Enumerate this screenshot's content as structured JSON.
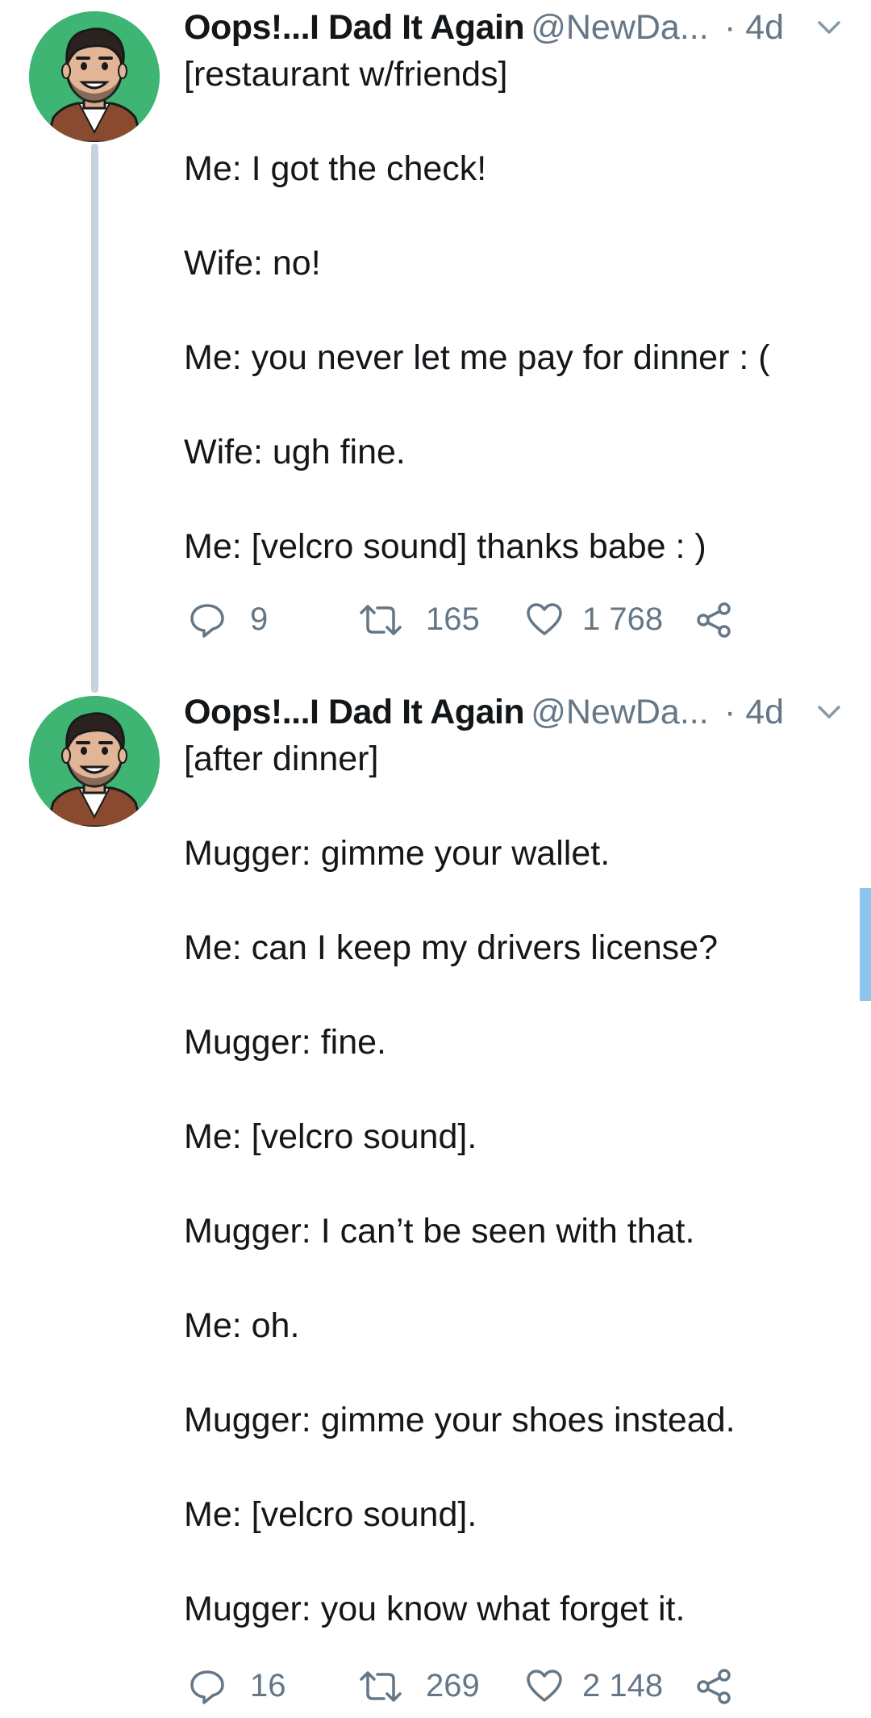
{
  "thread": {
    "tweets": [
      {
        "name": "Oops!...I Dad It Again",
        "handle": "@NewDa...",
        "time": "· 4d",
        "lines": [
          "[restaurant w/friends]",
          "Me: I got the check!",
          "Wife: no!",
          "Me: you never let me pay for dinner : (",
          "Wife: ugh fine.",
          "Me: [velcro sound] thanks babe : )"
        ],
        "replies": "9",
        "retweets": "165",
        "likes": "1 768"
      },
      {
        "name": "Oops!...I Dad It Again",
        "handle": "@NewDa...",
        "time": "· 4d",
        "lines": [
          "[after dinner]",
          "Mugger: gimme your wallet.",
          "Me: can I keep my drivers license?",
          "Mugger: fine.",
          "Me: [velcro sound].",
          "Mugger: I can’t be seen with that.",
          "Me: oh.",
          "Mugger: gimme your shoes instead.",
          "Me: [velcro sound].",
          "Mugger: you know what forget it."
        ],
        "replies": "16",
        "retweets": "269",
        "likes": "2 148"
      }
    ]
  },
  "icons": {
    "reply": "reply-icon",
    "retweet": "retweet-icon",
    "like": "heart-icon",
    "share": "share-icon",
    "menu": "chevron-down-icon"
  },
  "colors": {
    "text": "#14171a",
    "secondary": "#657786",
    "avatar_bg": "#3fb573",
    "thread_line": "#c6d2dd",
    "scroll_thumb": "#8ec5ee"
  }
}
